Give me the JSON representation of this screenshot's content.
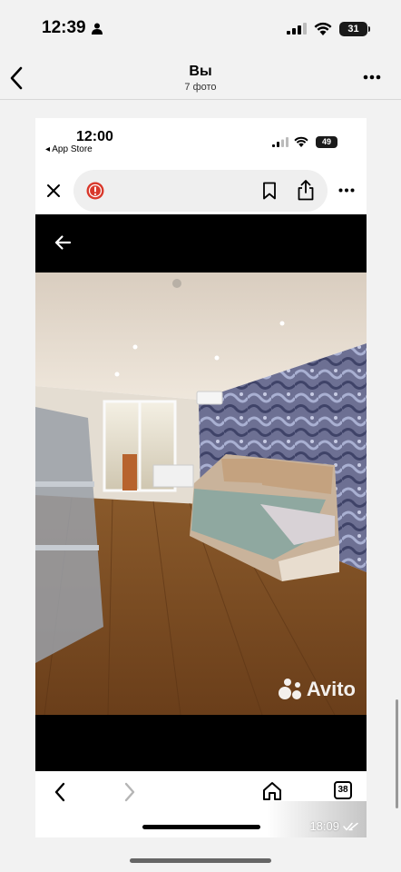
{
  "status_bar": {
    "time": "12:39",
    "battery": "31"
  },
  "header": {
    "title": "Вы",
    "subtitle": "7 фото"
  },
  "inner_screenshot": {
    "status_bar": {
      "time": "12:00",
      "back_app": "◂ App Store",
      "battery": "49"
    },
    "browser_bottom": {
      "tab_count": "38"
    },
    "watermark": "Avito"
  },
  "message": {
    "time": "18:09"
  },
  "colors": {
    "accent_red": "#d9382b",
    "black": "#000000",
    "wallpaper": "#6b6e8f",
    "floor": "#7a4a22"
  }
}
